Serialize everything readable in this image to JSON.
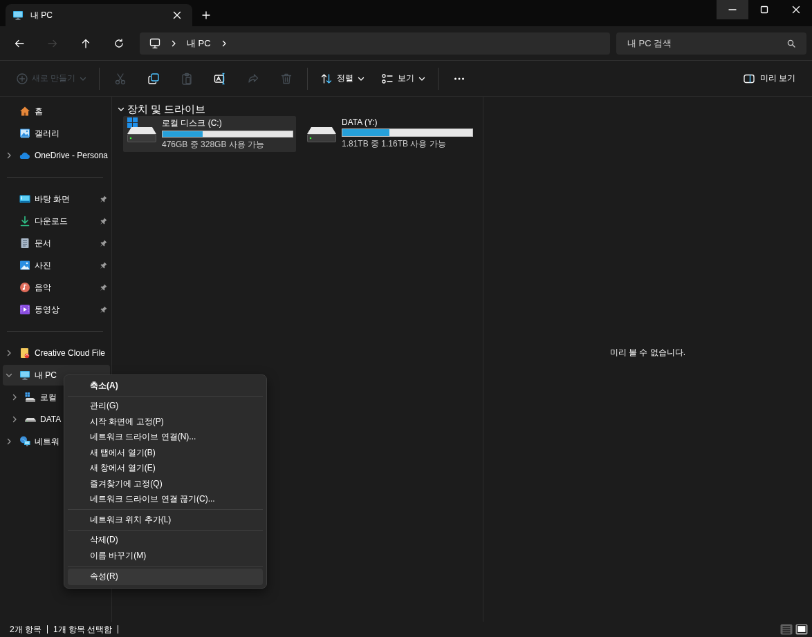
{
  "tabs": [
    {
      "title": "내 PC",
      "selected": true
    }
  ],
  "nav_buttons": [
    {
      "kind": "back",
      "disabled": false
    },
    {
      "kind": "forward",
      "disabled": true
    },
    {
      "kind": "up",
      "disabled": false
    },
    {
      "kind": "refresh",
      "disabled": false
    }
  ],
  "address": {
    "breadcrumb": [
      "내 PC"
    ]
  },
  "search": {
    "placeholder": "내 PC 검색"
  },
  "toolbar": {
    "groups": [
      [
        {
          "kind": "new",
          "label": "새로 만들기",
          "disabled": true
        }
      ],
      [
        {
          "kind": "cut",
          "disabled": true
        },
        {
          "kind": "copy",
          "disabled": false
        },
        {
          "kind": "paste",
          "disabled": true
        },
        {
          "kind": "rename",
          "disabled": false
        },
        {
          "kind": "share",
          "disabled": true
        },
        {
          "kind": "delete",
          "disabled": true
        }
      ],
      [
        {
          "kind": "sort",
          "label": "정렬",
          "disabled": false
        },
        {
          "kind": "view",
          "label": "보기",
          "disabled": false
        }
      ],
      [
        {
          "kind": "more",
          "disabled": false
        }
      ]
    ],
    "preview_button": "미리 보기"
  },
  "sidebar": {
    "sections": [
      [
        {
          "label": "홈",
          "kind": "home",
          "selected": false
        },
        {
          "label": "갤러리",
          "kind": "gallery",
          "selected": false
        },
        {
          "label": "OneDrive - Persona",
          "kind": "cloud",
          "expanded": false,
          "selected": false
        }
      ],
      [
        {
          "label": "바탕 화면",
          "kind": "desktop",
          "pinned": true,
          "selected": false
        },
        {
          "label": "다운로드",
          "kind": "download",
          "pinned": true,
          "selected": false
        },
        {
          "label": "문서",
          "kind": "document",
          "pinned": true,
          "selected": false
        },
        {
          "label": "사진",
          "kind": "photo",
          "pinned": true,
          "selected": false
        },
        {
          "label": "음악",
          "kind": "music",
          "pinned": true,
          "selected": false
        },
        {
          "label": "동영상",
          "kind": "video",
          "pinned": true,
          "selected": false
        }
      ],
      [
        {
          "label": "Creative Cloud File",
          "kind": "creative",
          "expanded": false,
          "selected": false
        },
        {
          "label": "내 PC",
          "kind": "monitor",
          "expanded": true,
          "selected": true,
          "children": [
            {
              "label": "로컬",
              "kind": "windrive",
              "expanded": false,
              "selected": false
            },
            {
              "label": "DATA",
              "kind": "drive",
              "expanded": false,
              "selected": false
            }
          ]
        },
        {
          "label": "네트워",
          "kind": "network",
          "expanded": false,
          "selected": false
        }
      ]
    ]
  },
  "section": {
    "title": "장치 및 드라이브",
    "expanded": true
  },
  "drives": [
    {
      "name": "로컬 디스크 (C:)",
      "windows": true,
      "level": 0.31,
      "reading": "476GB 중 328GB 사용 가능",
      "selected": true
    },
    {
      "name": "DATA (Y:)",
      "windows": false,
      "level": 0.36,
      "reading": "1.81TB 중 1.16TB 사용 가능",
      "selected": false
    }
  ],
  "preview": {
    "message": "미리 볼 수 없습니다."
  },
  "status_bar": {
    "texts": [
      "2개 항목",
      "1개 항목 선택함"
    ],
    "views": [
      {
        "kind": "details",
        "selected": false
      },
      {
        "kind": "tiles",
        "selected": true
      }
    ]
  },
  "context_menu": {
    "groups": [
      [
        {
          "label": "축소(A)",
          "default": true,
          "highlighted": false
        }
      ],
      [
        {
          "label": "관리(G)",
          "default": false,
          "highlighted": false
        },
        {
          "label": "시작 화면에 고정(P)",
          "default": false,
          "highlighted": false
        },
        {
          "label": "네트워크 드라이브 연결(N)...",
          "default": false,
          "highlighted": false
        },
        {
          "label": "새 탭에서 열기(B)",
          "default": false,
          "highlighted": false
        },
        {
          "label": "새 창에서 열기(E)",
          "default": false,
          "highlighted": false
        },
        {
          "label": "즐겨찾기에 고정(Q)",
          "default": false,
          "highlighted": false
        },
        {
          "label": "네트워크 드라이브 연결 끊기(C)...",
          "default": false,
          "highlighted": false
        }
      ],
      [
        {
          "label": "네트워크 위치 추가(L)",
          "default": false,
          "highlighted": false
        }
      ],
      [
        {
          "label": "삭제(D)",
          "default": false,
          "highlighted": false
        },
        {
          "label": "이름 바꾸기(M)",
          "default": false,
          "highlighted": false
        }
      ],
      [
        {
          "label": "속성(R)",
          "default": false,
          "highlighted": true
        }
      ]
    ]
  }
}
